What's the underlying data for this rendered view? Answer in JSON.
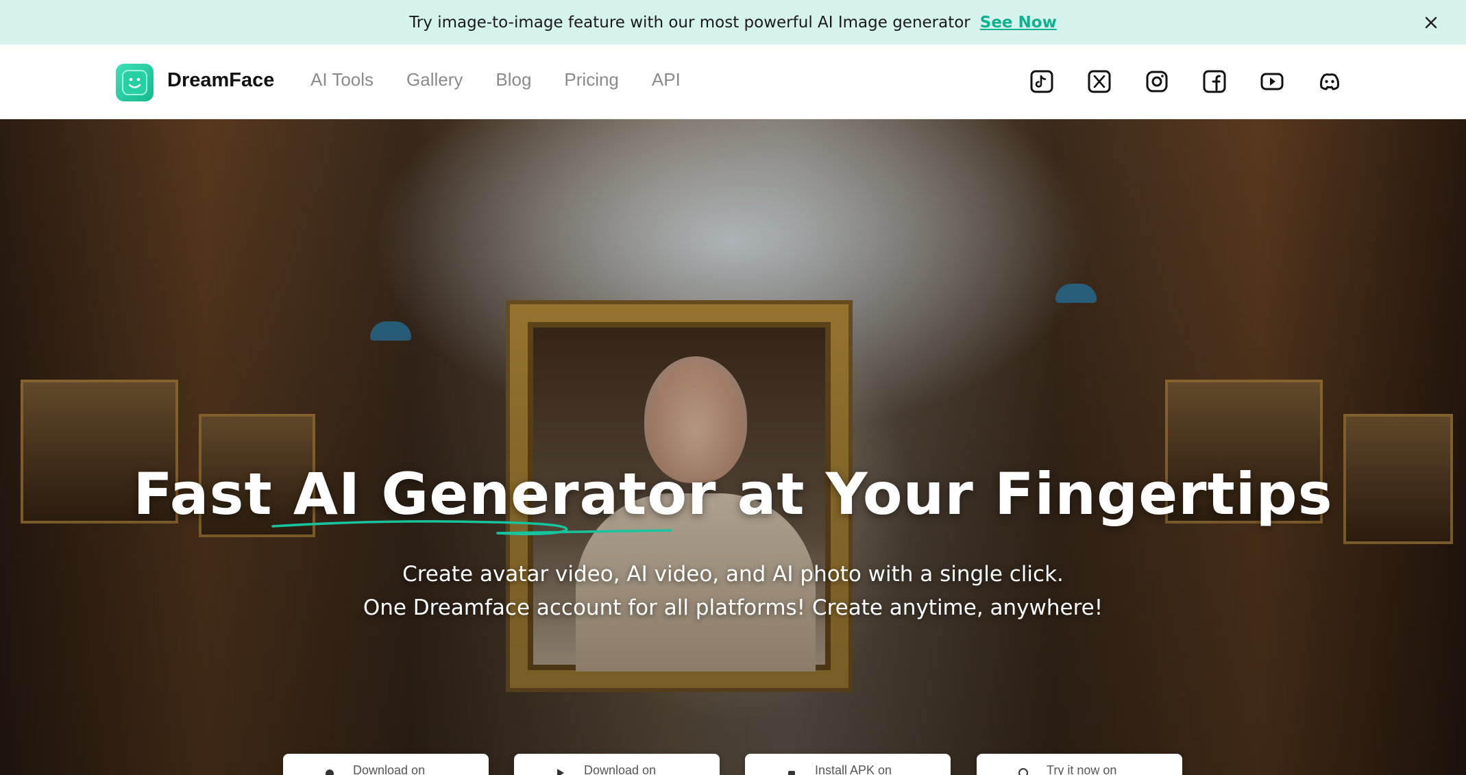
{
  "announcement": {
    "text": "Try image-to-image feature with our most powerful AI Image generator",
    "link": "See Now",
    "close_icon": "close-icon"
  },
  "header": {
    "brand": "DreamFace",
    "logo_icon": "dreamface-logo-icon",
    "nav": [
      {
        "label": "AI Tools"
      },
      {
        "label": "Gallery"
      },
      {
        "label": "Blog"
      },
      {
        "label": "Pricing"
      },
      {
        "label": "API"
      }
    ],
    "social_icons": [
      "tiktok-icon",
      "x-twitter-icon",
      "instagram-icon",
      "facebook-icon",
      "youtube-icon",
      "discord-icon"
    ]
  },
  "hero": {
    "title": "Fast AI Generator at Your Fingertips",
    "subtitle_line1": "Create avatar video, AI video, and AI photo with a single click.",
    "subtitle_line2": "One Dreamface account for all platforms! Create anytime, anywhere!",
    "buttons": [
      {
        "label": "Download on",
        "icon": "apple-icon"
      },
      {
        "label": "Download on",
        "icon": "google-play-icon"
      },
      {
        "label": "Install APK on",
        "icon": "android-icon"
      },
      {
        "label": "Try it now on",
        "icon": "web-icon"
      }
    ]
  },
  "colors": {
    "announcement_bg": "#d6f2ec",
    "accent": "#12b08f",
    "nav_text": "#8a8a8a",
    "title_underline": "#17c49e"
  }
}
